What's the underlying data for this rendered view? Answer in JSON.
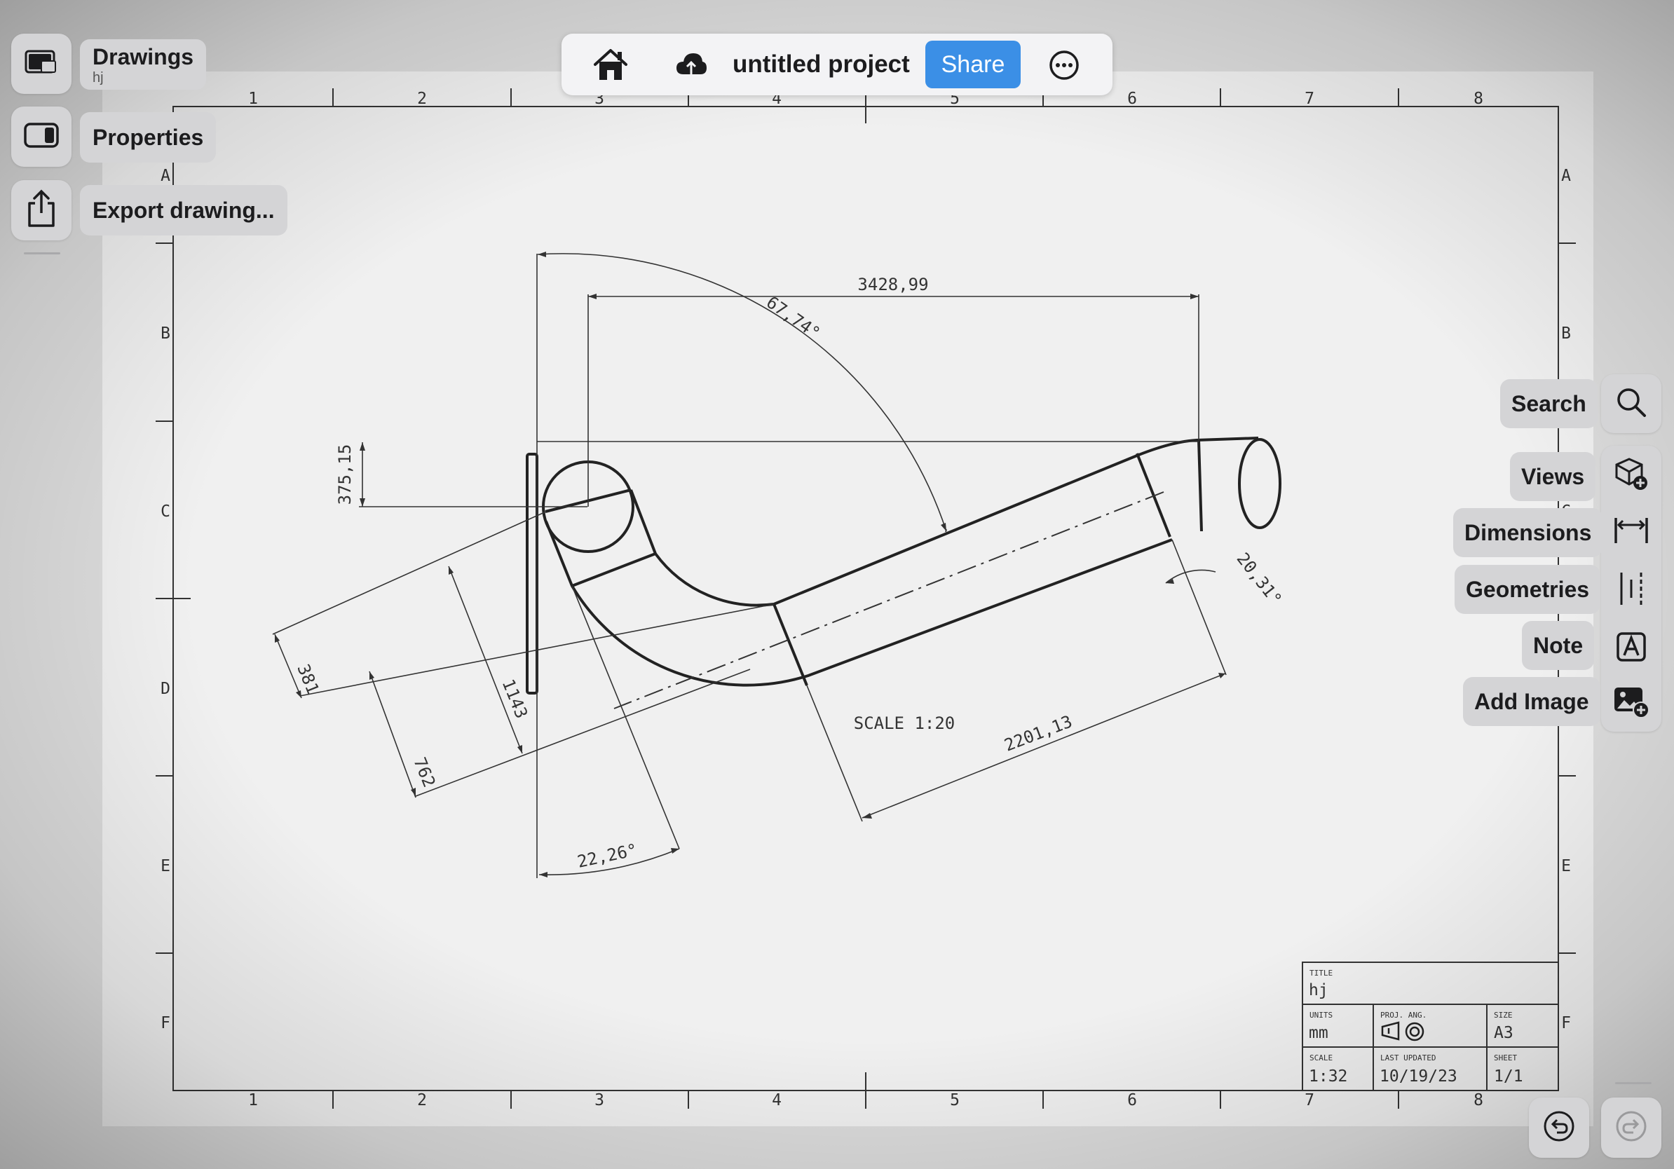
{
  "left_menu": {
    "drawings_label": "Drawings",
    "drawings_subtitle": "hj",
    "properties_label": "Properties",
    "export_label": "Export drawing..."
  },
  "topbar": {
    "project_title": "untitled project",
    "share_label": "Share"
  },
  "tools": {
    "search": "Search",
    "views": "Views",
    "dimensions": "Dimensions",
    "geometries": "Geometries",
    "note": "Note",
    "add_image": "Add Image"
  },
  "sheet": {
    "column_numbers": [
      "1",
      "2",
      "3",
      "4",
      "5",
      "6",
      "7",
      "8"
    ],
    "row_letters": [
      "A",
      "B",
      "C",
      "D",
      "E",
      "F"
    ],
    "scale_note": "SCALE 1:20"
  },
  "dimensions": {
    "d1": "3428,99",
    "d2": "67,74°",
    "d3": "375,15",
    "d4": "20,31°",
    "d5": "381",
    "d6": "1143",
    "d7": "762",
    "d8": "2201,13",
    "d9": "22,26°"
  },
  "title_block": {
    "title_label": "TITLE",
    "title_value": "hj",
    "units_label": "UNITS",
    "units_value": "mm",
    "proj_label": "PROJ. ANG.",
    "size_label": "SIZE",
    "size_value": "A3",
    "scale_label": "SCALE",
    "scale_value": "1:32",
    "updated_label": "LAST UPDATED",
    "updated_value": "10/19/23",
    "sheet_label": "SHEET",
    "sheet_value": "1/1"
  },
  "icons": [
    "drawings-icon",
    "sidebar-icon",
    "export-icon",
    "home-icon",
    "cloud-upload-icon",
    "more-icon",
    "search-icon",
    "views-icon",
    "dimensions-icon",
    "geometries-icon",
    "note-icon",
    "add-image-icon",
    "undo-icon",
    "redo-icon"
  ],
  "colors": {
    "accent": "#3b8fe6",
    "sheet": "#f0f0f0",
    "line": "#222222"
  }
}
